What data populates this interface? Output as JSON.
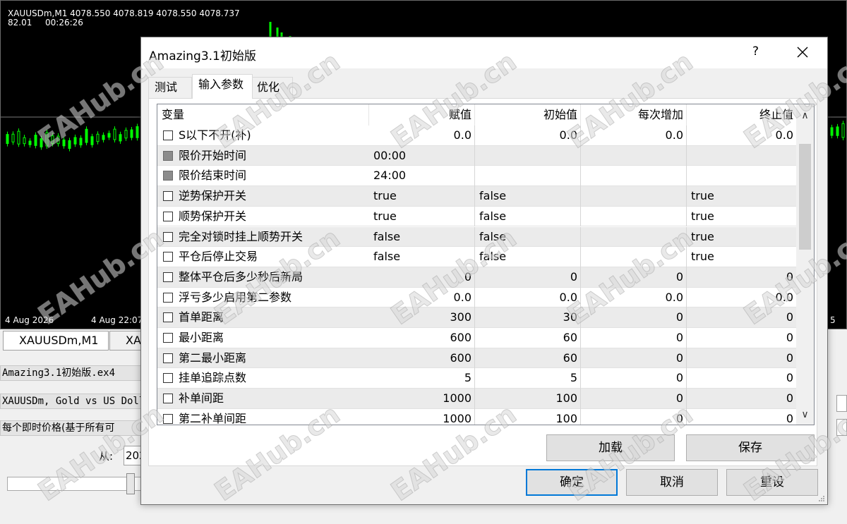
{
  "chart": {
    "symbol_line": "XAUUSDm,M1  4078.550 4078.819 4078.550 4078.737",
    "sub_line_a": "82.01",
    "sub_line_b": "00:26:26",
    "date1": "4 Aug 2026",
    "date2": "4 Aug 22:07",
    "date3": "5",
    "colors": {
      "bull": "#00ff00",
      "background": "#000000"
    }
  },
  "background": {
    "tab1": "XAUUSDm,M1",
    "tab2": "XA",
    "ea_file": "Amazing3.1初始版.ex4",
    "symbol_desc": "XAUUSDm, Gold vs US Doll",
    "model": "每个即时价格(基于所有可",
    "from_label": "从:",
    "from_value": "202"
  },
  "dialog": {
    "title": "Amazing3.1初始版",
    "help": "?",
    "tabs": [
      "测试",
      "输入参数",
      "优化"
    ],
    "active_tab": "输入参数",
    "columns": [
      "变量",
      "赋值",
      "初始值",
      "每次增加",
      "终止值"
    ],
    "rows": [
      {
        "name": "S以下不开(补)",
        "value": "0.0",
        "start": "0.0",
        "step": "0.0",
        "stop": "0.0",
        "align": "right",
        "gray": false
      },
      {
        "name": "限价开始时间",
        "value": "00:00",
        "start": "",
        "step": "",
        "stop": "",
        "align": "left",
        "gray": true
      },
      {
        "name": "限价结束时间",
        "value": "24:00",
        "start": "",
        "step": "",
        "stop": "",
        "align": "left",
        "gray": true
      },
      {
        "name": "逆势保护开关",
        "value": "true",
        "start": "false",
        "step": "",
        "stop": "true",
        "align": "left",
        "gray": false
      },
      {
        "name": "顺势保护开关",
        "value": "true",
        "start": "false",
        "step": "",
        "stop": "true",
        "align": "left",
        "gray": false
      },
      {
        "name": "完全对锁时挂上顺势开关",
        "value": "false",
        "start": "false",
        "step": "",
        "stop": "true",
        "align": "left",
        "gray": false
      },
      {
        "name": "平仓后停止交易",
        "value": "false",
        "start": "false",
        "step": "",
        "stop": "true",
        "align": "left",
        "gray": false
      },
      {
        "name": "整体平仓后多少秒后新局",
        "value": "0",
        "start": "0",
        "step": "0",
        "stop": "0",
        "align": "right",
        "gray": false
      },
      {
        "name": "浮亏多少启用第二参数",
        "value": "0.0",
        "start": "0.0",
        "step": "0.0",
        "stop": "0.0",
        "align": "right",
        "gray": false
      },
      {
        "name": "首单距离",
        "value": "300",
        "start": "30",
        "step": "0",
        "stop": "0",
        "align": "right",
        "gray": false
      },
      {
        "name": "最小距离",
        "value": "600",
        "start": "60",
        "step": "0",
        "stop": "0",
        "align": "right",
        "gray": false
      },
      {
        "name": "第二最小距离",
        "value": "600",
        "start": "60",
        "step": "0",
        "stop": "0",
        "align": "right",
        "gray": false
      },
      {
        "name": "挂单追踪点数",
        "value": "5",
        "start": "5",
        "step": "0",
        "stop": "0",
        "align": "right",
        "gray": false
      },
      {
        "name": "补单间距",
        "value": "1000",
        "start": "100",
        "step": "0",
        "stop": "0",
        "align": "right",
        "gray": false
      },
      {
        "name": "第二补单间距",
        "value": "1000",
        "start": "100",
        "step": "0",
        "stop": "0",
        "align": "right",
        "gray": false
      }
    ],
    "buttons": {
      "load": "加载",
      "save": "保存",
      "ok": "确定",
      "cancel": "取消",
      "reset": "重设"
    }
  },
  "watermark": "EAHub.cn"
}
